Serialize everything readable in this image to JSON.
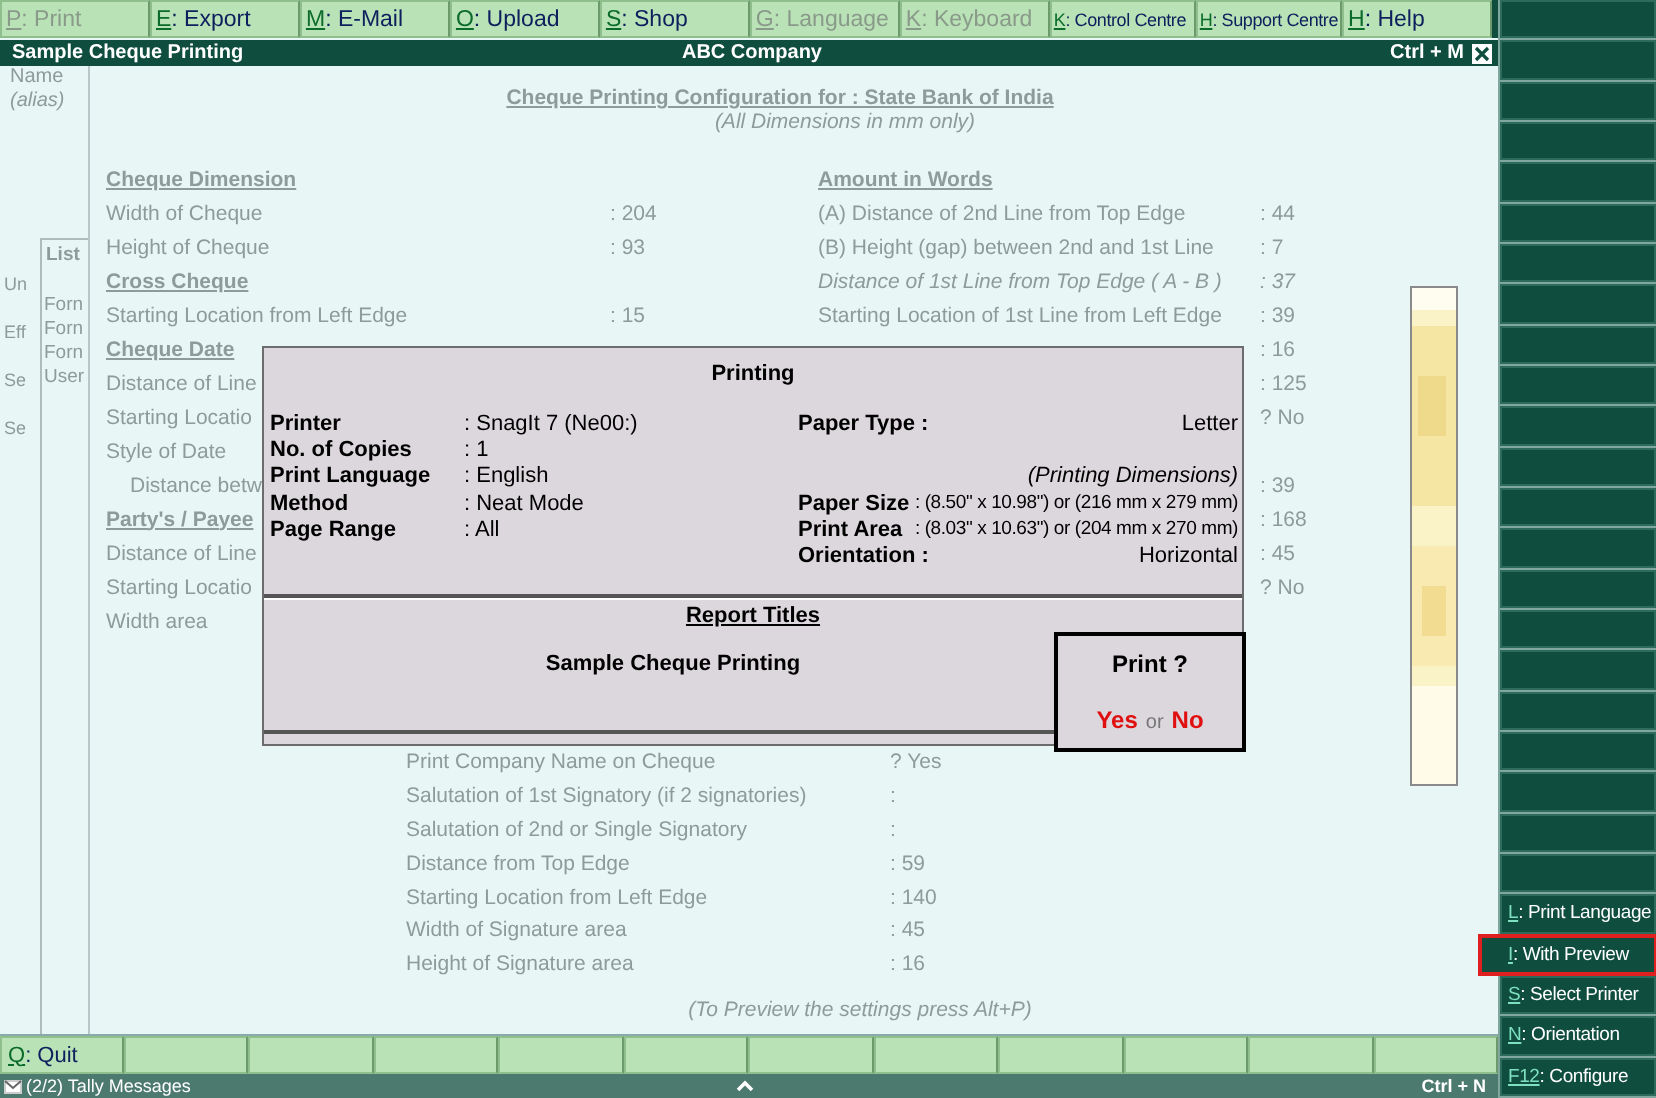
{
  "toolbar": [
    {
      "key": "P",
      "label": ": Print",
      "disabled": true
    },
    {
      "key": "E",
      "label": ": Export",
      "disabled": false
    },
    {
      "key": "M",
      "label": ": E-Mail",
      "disabled": false
    },
    {
      "key": "O",
      "label": ": Upload",
      "disabled": false
    },
    {
      "key": "S",
      "label": ": Shop",
      "disabled": false
    },
    {
      "key": "G",
      "label": ": Language",
      "disabled": true
    },
    {
      "key": "K",
      "label": ": Keyboard",
      "disabled": true
    },
    {
      "key": "K",
      "label": ": Control Centre",
      "disabled": false
    },
    {
      "key": "H",
      "label": ": Support Centre",
      "disabled": false
    },
    {
      "key": "H",
      "label": ": Help",
      "disabled": false
    }
  ],
  "window": {
    "title": "Sample Cheque Printing",
    "company": "ABC Company",
    "shortcut": "Ctrl + M"
  },
  "back_panel": {
    "header_labels": [
      {
        "text": "Name",
        "kind": "plain"
      },
      {
        "text": "(alias)",
        "kind": "italic"
      }
    ],
    "side_labels": [
      "Un",
      "Eff",
      "Se",
      "Se"
    ]
  },
  "list_panel": {
    "title": "List",
    "items": [
      "Forn",
      "Forn",
      "Forn",
      "User"
    ]
  },
  "config": {
    "title": "Cheque Printing Configuration for : State Bank of India",
    "subtitle": "(All Dimensions in mm only)",
    "rows": [
      {
        "left": {
          "label": "Cheque Dimension",
          "kind": "heading"
        },
        "right": {
          "label": "Amount in Words",
          "kind": "heading"
        }
      },
      {
        "left": {
          "label": "Width of Cheque",
          "value": ": 204",
          "kind": "field"
        },
        "right": {
          "label": "(A) Distance of 2nd Line from Top Edge",
          "value": ": 44",
          "kind": "field"
        }
      },
      {
        "left": {
          "label": "Height of Cheque",
          "value": ": 93",
          "kind": "field"
        },
        "right": {
          "label": "(B) Height (gap) between 2nd and 1st Line",
          "value": ": 7",
          "kind": "field"
        }
      },
      {
        "left": {
          "label": "Cross Cheque",
          "kind": "heading"
        },
        "right": {
          "label": "Distance of 1st Line from Top Edge ( A - B )",
          "value": ": 37",
          "kind": "italic"
        }
      },
      {
        "left": {
          "label": "Starting Location from Left Edge",
          "value": ": 15",
          "kind": "field"
        },
        "right": {
          "label": "Starting Location of 1st Line from Left Edge",
          "value": ": 39",
          "kind": "field"
        }
      },
      {
        "left": {
          "label": "Cheque Date",
          "kind": "heading"
        },
        "right": {
          "value": ": 16",
          "kind": "field"
        }
      },
      {
        "left": {
          "label": "Distance of Line",
          "kind": "field"
        },
        "right": {
          "value": ": 125",
          "kind": "field"
        }
      },
      {
        "left": {
          "label": "Starting Locatio",
          "kind": "field"
        },
        "right": {
          "value": "? No",
          "kind": "field"
        }
      },
      {
        "left": {
          "label": "Style of Date",
          "kind": "field"
        }
      },
      {
        "left": {
          "label": "Distance betw",
          "kind": "indent"
        },
        "right": {
          "value": ": 39",
          "kind": "field"
        }
      },
      {
        "left": {
          "label": "Party's / Payee",
          "kind": "heading"
        },
        "right": {
          "value": ": 168",
          "kind": "field"
        }
      },
      {
        "left": {
          "label": "Distance of Line",
          "kind": "field"
        },
        "right": {
          "value": ": 45",
          "kind": "field"
        }
      },
      {
        "left": {
          "label": "Starting Locatio",
          "kind": "field"
        },
        "right": {
          "value": "? No",
          "kind": "field"
        }
      },
      {
        "left": {
          "label": "Width area",
          "kind": "field"
        }
      }
    ],
    "lower_rows": [
      {
        "label": "Print Company Name on Cheque",
        "value": "? Yes"
      },
      {
        "label": "Salutation of 1st Signatory (if 2 signatories)",
        "value": ":"
      },
      {
        "label": "Salutation of 2nd or Single Signatory",
        "value": ":"
      },
      {
        "label": "Distance from Top Edge",
        "value": ": 59"
      },
      {
        "label": "Starting Location from Left Edge",
        "value": ": 140"
      },
      {
        "label": "Width of Signature area",
        "value": ": 45"
      },
      {
        "label": "Height of Signature area",
        "value": ": 16"
      }
    ],
    "hint": "(To Preview the settings press Alt+P)"
  },
  "print_dialog": {
    "title": "Printing",
    "settings": [
      {
        "label": "Printer",
        "value": ": SnagIt 7 (Ne00:)"
      },
      {
        "label": "No. of Copies",
        "value": ": 1"
      },
      {
        "label": "Print Language",
        "value": ": English"
      },
      {
        "label": "Method",
        "value": ": Neat Mode"
      },
      {
        "label": "Page Range",
        "value": ": All"
      }
    ],
    "paper": [
      {
        "label": "Paper Type :",
        "value": "Letter",
        "kind": "pair"
      },
      {
        "value": "(Printing Dimensions)",
        "kind": "note"
      },
      {
        "label": "Paper Size",
        "value": ": (8.50\" x 10.98\") or (216 mm x 279 mm)",
        "kind": "size"
      },
      {
        "label": "Print Area",
        "value": ": (8.03\" x 10.63\") or (204 mm x 270 mm)",
        "kind": "size"
      },
      {
        "label": "Orientation :",
        "value": "Horizontal",
        "kind": "pair"
      }
    ],
    "section_title": "Report Titles",
    "report_title": "Sample Cheque Printing",
    "prompt": {
      "question": "Print ?",
      "yes": "Yes",
      "or": "or",
      "no": "No"
    }
  },
  "side_buttons": [
    {
      "key": "L",
      "label": ": Print Language",
      "highlighted": false
    },
    {
      "key": "I",
      "label": ": With Preview",
      "highlighted": true
    },
    {
      "key": "S",
      "label": ": Select Printer",
      "highlighted": false
    },
    {
      "key": "N",
      "label": ": Orientation",
      "highlighted": false
    },
    {
      "key": "F12",
      "label": ": Configure",
      "highlighted": false
    }
  ],
  "bottom_buttons": [
    {
      "key": "Q",
      "label": ": Quit"
    }
  ],
  "status_bar": {
    "messages": "(2/2) Tally Messages",
    "shortcut": "Ctrl + N"
  }
}
